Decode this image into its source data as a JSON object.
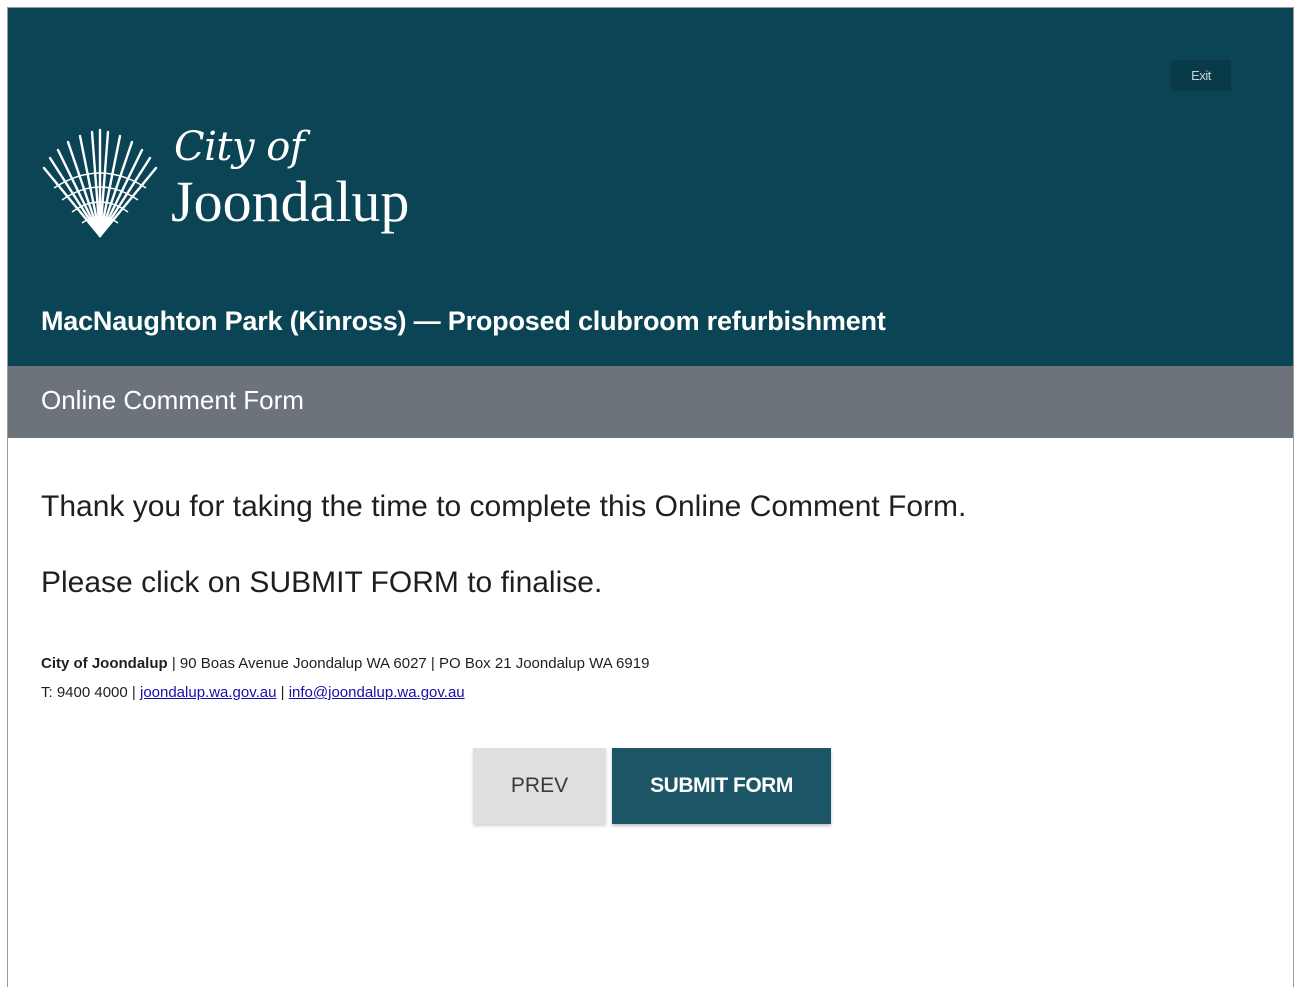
{
  "header": {
    "exit_label": "Exit",
    "logo": {
      "line1": "City of",
      "line2": "Joondalup"
    },
    "project_title": "MacNaughton Park (Kinross) — Proposed clubroom refurbishment"
  },
  "subheader": {
    "title": "Online Comment Form"
  },
  "content": {
    "thanks": "Thank you for taking the time to complete this Online Comment Form.",
    "instruction": "Please click on SUBMIT FORM to finalise."
  },
  "footer": {
    "org_name": "City of Joondalup",
    "address": " | 90 Boas Avenue Joondalup WA 6027 | PO Box 21 Joondalup WA 6919",
    "phone": "T: 9400 4000 | ",
    "website": "joondalup.wa.gov.au",
    "separator": " | ",
    "email": "info@joondalup.wa.gov.au"
  },
  "buttons": {
    "prev_label": "PREV",
    "submit_label": "SUBMIT FORM"
  },
  "colors": {
    "header_bg": "#0a4455",
    "subheader_bg": "#6d737a",
    "submit_bg": "#1b5566",
    "prev_bg": "#e0e0e0",
    "link": "#1a0dab"
  }
}
